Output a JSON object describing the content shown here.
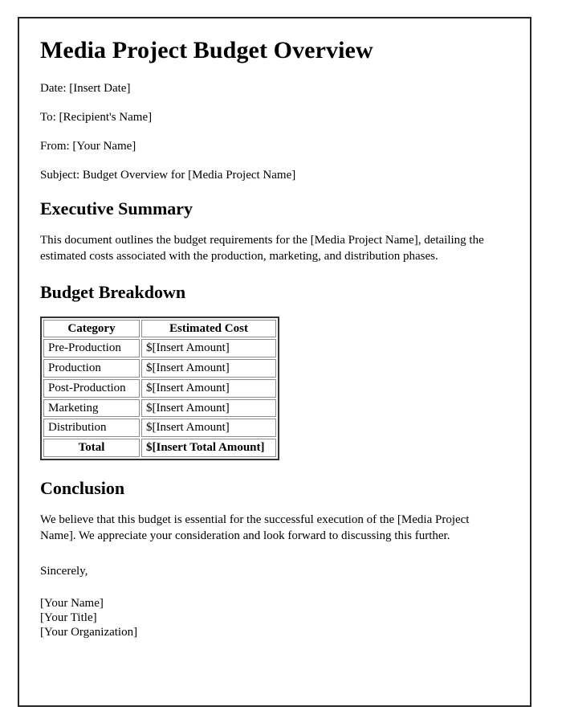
{
  "document": {
    "title": "Media Project Budget Overview",
    "meta": [
      {
        "label": "date",
        "text": "Date: [Insert Date]"
      },
      {
        "label": "to",
        "text": "To: [Recipient's Name]"
      },
      {
        "label": "from",
        "text": "From: [Your Name]"
      },
      {
        "label": "subject",
        "text": "Subject: Budget Overview for [Media Project Name]"
      }
    ],
    "executive_summary": {
      "heading": "Executive Summary",
      "paragraph": "This document outlines the budget requirements for the [Media Project Name], detailing the estimated costs associated with the production, marketing, and distribution phases."
    },
    "budget_breakdown": {
      "heading": "Budget Breakdown",
      "table": {
        "columns": [
          "Category",
          "Estimated Cost"
        ],
        "rows": [
          [
            "Pre-Production",
            "$[Insert Amount]"
          ],
          [
            "Production",
            "$[Insert Amount]"
          ],
          [
            "Post-Production",
            "$[Insert Amount]"
          ],
          [
            "Marketing",
            "$[Insert Amount]"
          ],
          [
            "Distribution",
            "$[Insert Amount]"
          ]
        ],
        "total_row": [
          "Total",
          "$[Insert Total Amount]"
        ]
      }
    },
    "conclusion": {
      "heading": "Conclusion",
      "paragraph": "We believe that this budget is essential for the successful execution of the [Media Project Name]. We appreciate your consideration and look forward to discussing this further.",
      "sign_off": "Sincerely,",
      "signature": "[Your Name]\n[Your Title]\n[Your Organization]"
    }
  }
}
